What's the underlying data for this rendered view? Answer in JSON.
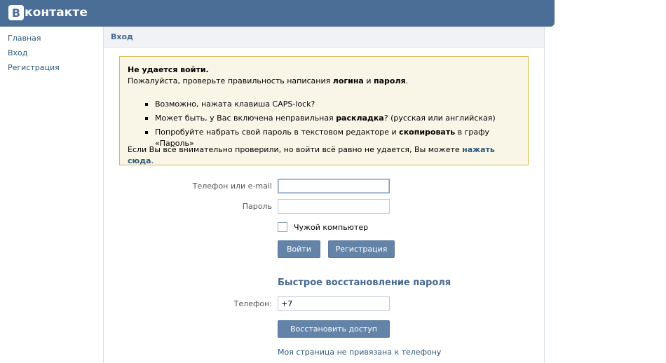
{
  "header": {
    "logo_badge": "В",
    "logo_text": "контакте"
  },
  "left_nav": {
    "items": [
      {
        "label": "Главная"
      },
      {
        "label": "Вход"
      },
      {
        "label": "Регистрация"
      }
    ]
  },
  "main": {
    "title": "Вход",
    "notice": {
      "title": "Не удается войти.",
      "intro_start": "Пожалуйста, проверьте правильность написания ",
      "intro_bold1": "логина",
      "intro_mid": " и ",
      "intro_bold2": "пароля",
      "intro_end": ".",
      "bullets": [
        {
          "text1": "Возможно, нажата клавиша CAPS-lock?",
          "bold": "",
          "text2": ""
        },
        {
          "text1": "Может быть, у Вас включена неправильная ",
          "bold": "раскладка",
          "text2": "? (русская или английская)"
        },
        {
          "text1": "Попробуйте набрать свой пароль в текстовом редакторе и ",
          "bold": "скопировать",
          "text2": " в графу «Пароль»"
        }
      ],
      "footer_text": "Если Вы всё внимательно проверили, но войти всё равно не удается, Вы можете ",
      "footer_link": "нажать сюда",
      "footer_end": "."
    },
    "login_form": {
      "email_label": "Телефон или e-mail",
      "email_value": "",
      "password_label": "Пароль",
      "password_value": "",
      "checkbox_label": "Чужой компьютер",
      "checkbox_checked": false,
      "login_button": "Войти",
      "register_button": "Регистрация"
    },
    "recovery": {
      "title": "Быстрое восстановление пароля",
      "phone_label": "Телефон:",
      "phone_value": "+7",
      "restore_button": "Восстановить доступ",
      "no_phone_link": "Моя страница не привязана к телефону"
    }
  },
  "colors": {
    "brand": "#4a6e95",
    "link": "#2b587a",
    "button": "#6383a8",
    "notice_bg": "#f9f6e7",
    "notice_border": "#d4bc4c"
  }
}
